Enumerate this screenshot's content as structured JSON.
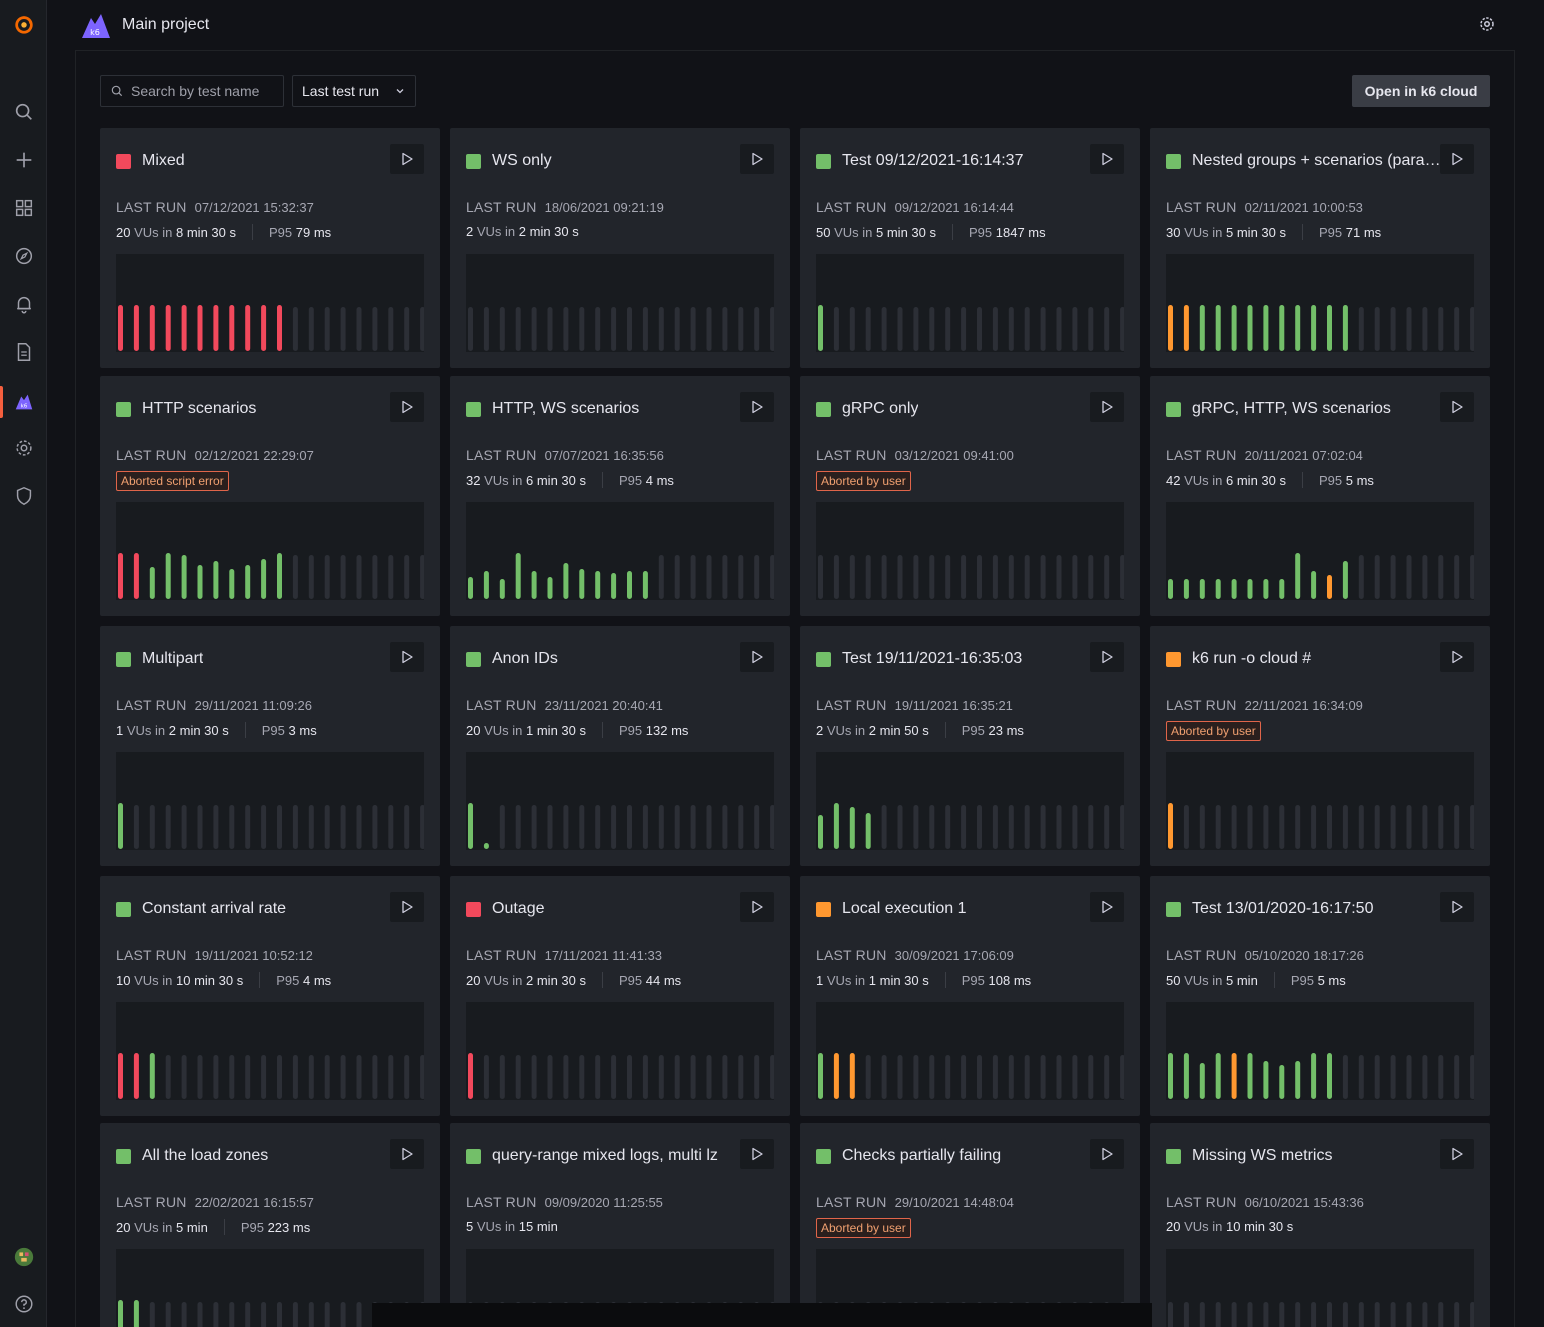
{
  "topbar": {
    "project_title": "Main project"
  },
  "toolbar": {
    "search_placeholder": "Search by test name",
    "sort_value": "Last test run",
    "open_cloud_label": "Open in k6 cloud"
  },
  "colors": {
    "green": "#73bf69",
    "red": "#f2495c",
    "orange": "#ff9830",
    "empty": "#2c2f36"
  },
  "labels": {
    "last_run": "LAST RUN",
    "vus_in": "VUs in",
    "p95": "P95"
  },
  "tests": [
    {
      "name": "Mixed",
      "status": "red",
      "last_run": "07/12/2021 15:32:37",
      "vus": "20",
      "duration": "8 min 30 s",
      "p95": "79 ms",
      "badge": "",
      "bars": [
        "r",
        "r",
        "r",
        "r",
        "r",
        "r",
        "r",
        "r",
        "r",
        "r",
        "r",
        "e",
        "e",
        "e",
        "e",
        "e",
        "e",
        "e",
        "e",
        "e"
      ]
    },
    {
      "name": "WS only",
      "status": "green",
      "last_run": "18/06/2021 09:21:19",
      "vus": "2",
      "duration": "2 min 30 s",
      "p95": "",
      "badge": "",
      "bars": [
        "e",
        "e",
        "e",
        "e",
        "e",
        "e",
        "e",
        "e",
        "e",
        "e",
        "e",
        "e",
        "e",
        "e",
        "e",
        "e",
        "e",
        "e",
        "e",
        "e"
      ]
    },
    {
      "name": "Test 09/12/2021-16:14:37",
      "status": "green",
      "last_run": "09/12/2021 16:14:44",
      "vus": "50",
      "duration": "5 min 30 s",
      "p95": "1847 ms",
      "badge": "",
      "bars": [
        "g",
        "e",
        "e",
        "e",
        "e",
        "e",
        "e",
        "e",
        "e",
        "e",
        "e",
        "e",
        "e",
        "e",
        "e",
        "e",
        "e",
        "e",
        "e",
        "e"
      ]
    },
    {
      "name": "Nested groups + scenarios (parallel)",
      "status": "green",
      "last_run": "02/11/2021 10:00:53",
      "vus": "30",
      "duration": "5 min 30 s",
      "p95": "71 ms",
      "badge": "",
      "bars": [
        "o",
        "o",
        "g",
        "g",
        "g",
        "g",
        "g",
        "g",
        "g",
        "g",
        "g",
        "g",
        "e",
        "e",
        "e",
        "e",
        "e",
        "e",
        "e",
        "e"
      ]
    },
    {
      "name": "HTTP scenarios",
      "status": "green",
      "last_run": "02/12/2021 22:29:07",
      "vus": "",
      "duration": "",
      "p95": "",
      "badge": "Aborted script error",
      "bars": [
        "r",
        "r",
        "g",
        "g",
        "g",
        "g",
        "g",
        "g",
        "g",
        "g",
        "g",
        "e",
        "e",
        "e",
        "e",
        "e",
        "e",
        "e",
        "e",
        "e"
      ],
      "heights": [
        46,
        46,
        32,
        46,
        44,
        34,
        38,
        30,
        34,
        40,
        46
      ]
    },
    {
      "name": "HTTP, WS scenarios",
      "status": "green",
      "last_run": "07/07/2021 16:35:56",
      "vus": "32",
      "duration": "6 min 30 s",
      "p95": "4 ms",
      "badge": "",
      "bars": [
        "g",
        "g",
        "g",
        "g",
        "g",
        "g",
        "g",
        "g",
        "g",
        "g",
        "g",
        "g",
        "e",
        "e",
        "e",
        "e",
        "e",
        "e",
        "e",
        "e"
      ],
      "heights": [
        22,
        28,
        20,
        46,
        28,
        22,
        36,
        30,
        28,
        26,
        28,
        28
      ]
    },
    {
      "name": "gRPC only",
      "status": "green",
      "last_run": "03/12/2021 09:41:00",
      "vus": "",
      "duration": "",
      "p95": "",
      "badge": "Aborted by user",
      "bars": [
        "e",
        "e",
        "e",
        "e",
        "e",
        "e",
        "e",
        "e",
        "e",
        "e",
        "e",
        "e",
        "e",
        "e",
        "e",
        "e",
        "e",
        "e",
        "e",
        "e"
      ]
    },
    {
      "name": "gRPC, HTTP, WS scenarios",
      "status": "green",
      "last_run": "20/11/2021 07:02:04",
      "vus": "42",
      "duration": "6 min 30 s",
      "p95": "5 ms",
      "badge": "",
      "bars": [
        "g",
        "g",
        "g",
        "g",
        "g",
        "g",
        "g",
        "g",
        "g",
        "g",
        "o",
        "g",
        "e",
        "e",
        "e",
        "e",
        "e",
        "e",
        "e",
        "e"
      ],
      "heights": [
        20,
        20,
        20,
        20,
        20,
        20,
        20,
        20,
        46,
        28,
        24,
        38
      ]
    },
    {
      "name": "Multipart",
      "status": "green",
      "last_run": "29/11/2021 11:09:26",
      "vus": "1",
      "duration": "2 min 30 s",
      "p95": "3 ms",
      "badge": "",
      "bars": [
        "g",
        "e",
        "e",
        "e",
        "e",
        "e",
        "e",
        "e",
        "e",
        "e",
        "e",
        "e",
        "e",
        "e",
        "e",
        "e",
        "e",
        "e",
        "e",
        "e"
      ]
    },
    {
      "name": "Anon IDs",
      "status": "green",
      "last_run": "23/11/2021 20:40:41",
      "vus": "20",
      "duration": "1 min 30 s",
      "p95": "132 ms",
      "badge": "",
      "bars": [
        "g",
        "g",
        "e",
        "e",
        "e",
        "e",
        "e",
        "e",
        "e",
        "e",
        "e",
        "e",
        "e",
        "e",
        "e",
        "e",
        "e",
        "e",
        "e",
        "e"
      ],
      "heights": [
        46,
        6
      ]
    },
    {
      "name": "Test 19/11/2021-16:35:03",
      "status": "green",
      "last_run": "19/11/2021 16:35:21",
      "vus": "2",
      "duration": "2 min 50 s",
      "p95": "23 ms",
      "badge": "",
      "bars": [
        "g",
        "g",
        "g",
        "g",
        "e",
        "e",
        "e",
        "e",
        "e",
        "e",
        "e",
        "e",
        "e",
        "e",
        "e",
        "e",
        "e",
        "e",
        "e",
        "e"
      ],
      "heights": [
        34,
        46,
        42,
        36
      ]
    },
    {
      "name": "k6 run -o cloud #",
      "status": "orange",
      "last_run": "22/11/2021 16:34:09",
      "vus": "",
      "duration": "",
      "p95": "",
      "badge": "Aborted by user",
      "bars": [
        "o",
        "e",
        "e",
        "e",
        "e",
        "e",
        "e",
        "e",
        "e",
        "e",
        "e",
        "e",
        "e",
        "e",
        "e",
        "e",
        "e",
        "e",
        "e",
        "e"
      ]
    },
    {
      "name": "Constant arrival rate",
      "status": "green",
      "last_run": "19/11/2021 10:52:12",
      "vus": "10",
      "duration": "10 min 30 s",
      "p95": "4 ms",
      "badge": "",
      "bars": [
        "r",
        "r",
        "g",
        "e",
        "e",
        "e",
        "e",
        "e",
        "e",
        "e",
        "e",
        "e",
        "e",
        "e",
        "e",
        "e",
        "e",
        "e",
        "e",
        "e"
      ]
    },
    {
      "name": "Outage",
      "status": "red",
      "last_run": "17/11/2021 11:41:33",
      "vus": "20",
      "duration": "2 min 30 s",
      "p95": "44 ms",
      "badge": "",
      "bars": [
        "r",
        "e",
        "e",
        "e",
        "e",
        "e",
        "e",
        "e",
        "e",
        "e",
        "e",
        "e",
        "e",
        "e",
        "e",
        "e",
        "e",
        "e",
        "e",
        "e"
      ]
    },
    {
      "name": "Local execution 1",
      "status": "orange",
      "last_run": "30/09/2021 17:06:09",
      "vus": "1",
      "duration": "1 min 30 s",
      "p95": "108 ms",
      "badge": "",
      "bars": [
        "g",
        "o",
        "o",
        "e",
        "e",
        "e",
        "e",
        "e",
        "e",
        "e",
        "e",
        "e",
        "e",
        "e",
        "e",
        "e",
        "e",
        "e",
        "e",
        "e"
      ]
    },
    {
      "name": "Test 13/01/2020-16:17:50",
      "status": "green",
      "last_run": "05/10/2020 18:17:26",
      "vus": "50",
      "duration": "5 min",
      "p95": "5 ms",
      "badge": "",
      "bars": [
        "g",
        "g",
        "g",
        "g",
        "o",
        "g",
        "g",
        "g",
        "g",
        "g",
        "g",
        "e",
        "e",
        "e",
        "e",
        "e",
        "e",
        "e",
        "e",
        "e"
      ],
      "heights": [
        46,
        46,
        36,
        46,
        46,
        46,
        38,
        34,
        38,
        46,
        46
      ]
    },
    {
      "name": "All the load zones",
      "status": "green",
      "last_run": "22/02/2021 16:15:57",
      "vus": "20",
      "duration": "5 min",
      "p95": "223 ms",
      "badge": "",
      "bars": [
        "g",
        "g",
        "e",
        "e",
        "e",
        "e",
        "e",
        "e",
        "e",
        "e",
        "e",
        "e",
        "e",
        "e",
        "e",
        "e",
        "e",
        "e",
        "e",
        "e"
      ]
    },
    {
      "name": "query-range mixed logs, multi lz",
      "status": "green",
      "last_run": "09/09/2020 11:25:55",
      "vus": "5",
      "duration": "15 min",
      "p95": "",
      "badge": "",
      "bars": [
        "e",
        "e",
        "e",
        "e",
        "e",
        "e",
        "e",
        "e",
        "e",
        "e",
        "e",
        "e",
        "e",
        "e",
        "e",
        "e",
        "e",
        "e",
        "e",
        "e"
      ]
    },
    {
      "name": "Checks partially failing",
      "status": "green",
      "last_run": "29/10/2021 14:48:04",
      "vus": "",
      "duration": "",
      "p95": "",
      "badge": "Aborted by user",
      "bars": [
        "e",
        "e",
        "e",
        "e",
        "e",
        "e",
        "e",
        "e",
        "e",
        "e",
        "e",
        "e",
        "e",
        "e",
        "e",
        "e",
        "e",
        "e",
        "e",
        "e"
      ]
    },
    {
      "name": "Missing WS metrics",
      "status": "green",
      "last_run": "06/10/2021 15:43:36",
      "vus": "20",
      "duration": "10 min 30 s",
      "p95": "",
      "badge": "",
      "bars": [
        "e",
        "e",
        "e",
        "e",
        "e",
        "e",
        "e",
        "e",
        "e",
        "e",
        "e",
        "e",
        "e",
        "e",
        "e",
        "e",
        "e",
        "e",
        "e",
        "e"
      ]
    }
  ]
}
